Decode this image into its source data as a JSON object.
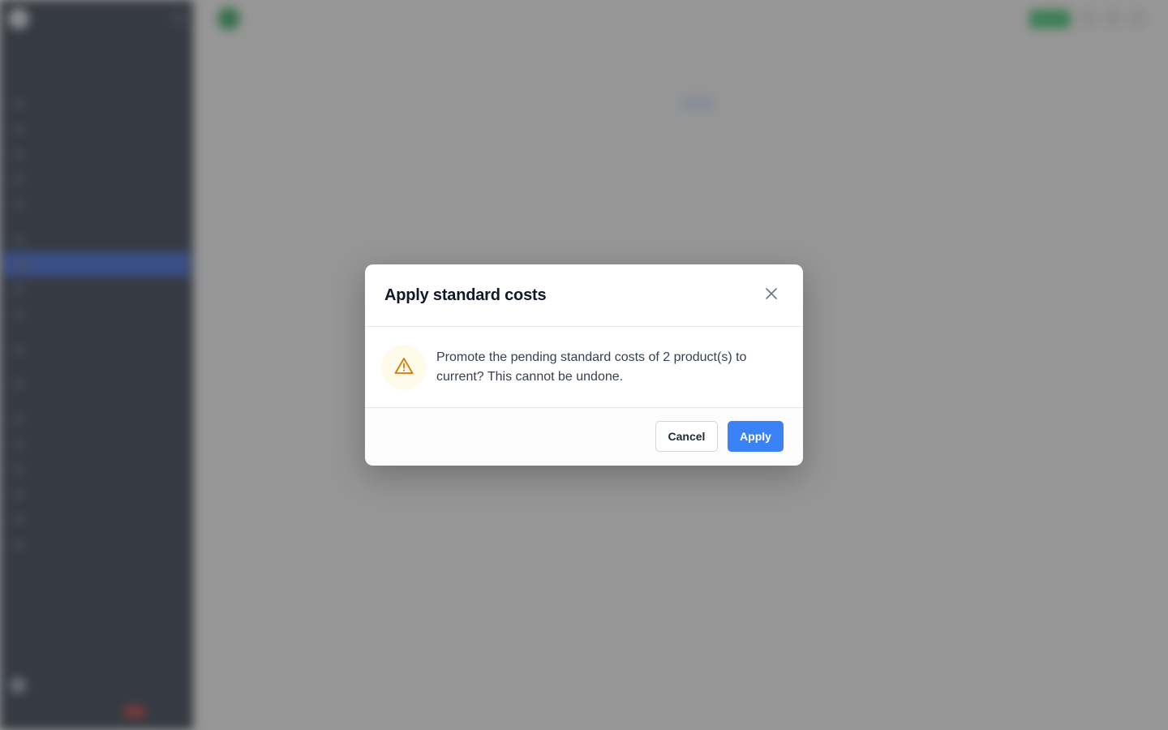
{
  "modal": {
    "title": "Apply standard costs",
    "message": "Promote the pending standard costs of 2 product(s) to current? This cannot be undone.",
    "cancel_label": "Cancel",
    "apply_label": "Apply",
    "icons": {
      "close": "close-icon",
      "warning": "warning-icon"
    },
    "colors": {
      "primary": "#3b82f6",
      "warning": "#d97706",
      "warning_bg": "#fffbeb",
      "overlay": "#505050"
    }
  }
}
